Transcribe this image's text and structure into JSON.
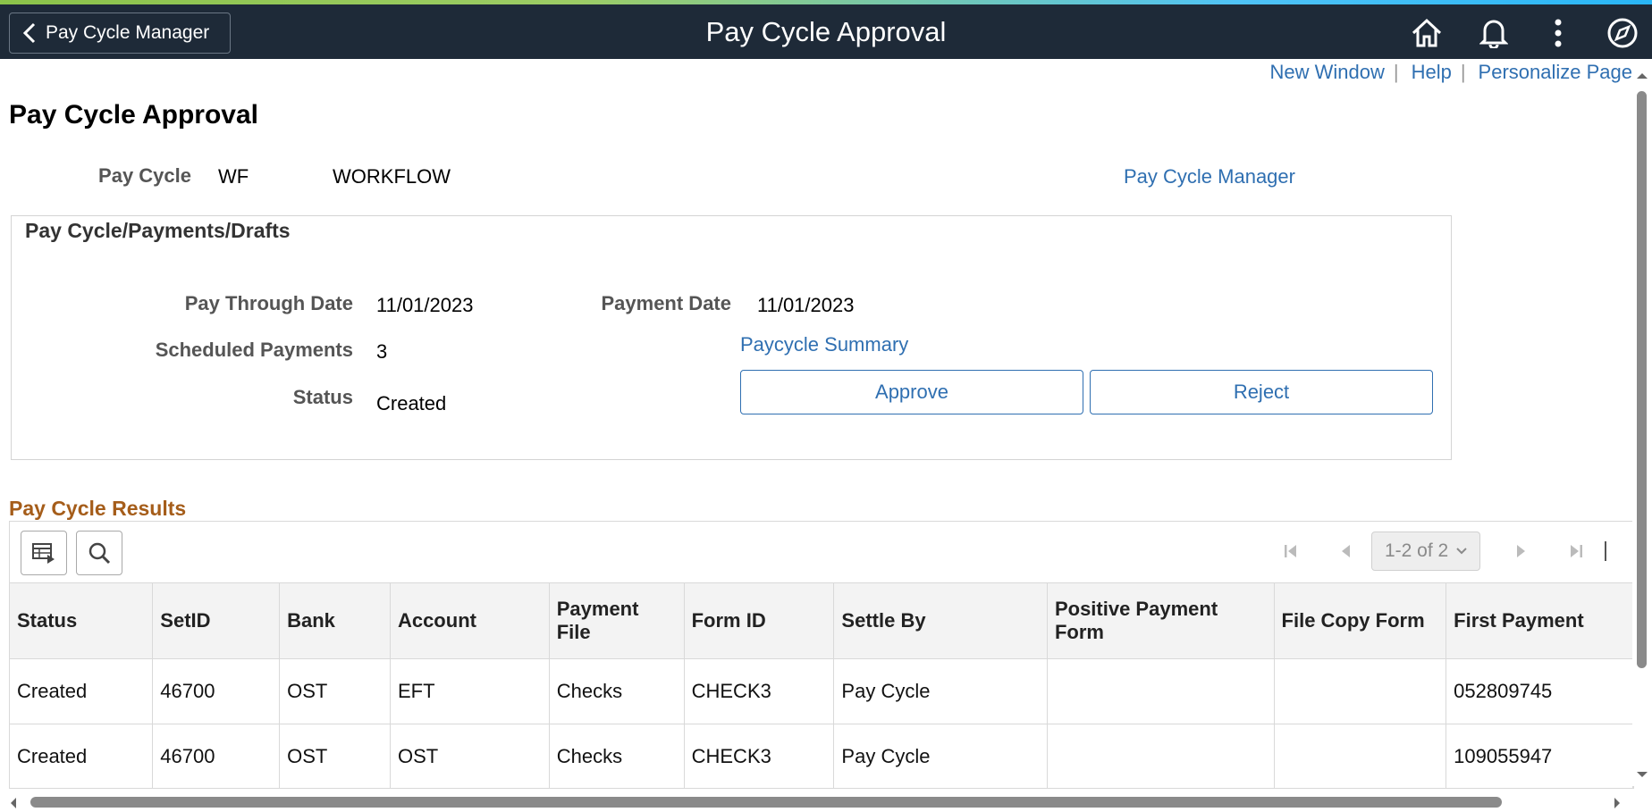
{
  "header": {
    "back_label": "Pay Cycle Manager",
    "title": "Pay Cycle Approval",
    "icons": [
      "home-icon",
      "notifications-icon",
      "actions-menu-icon",
      "navbar-compass-icon"
    ]
  },
  "utility_links": {
    "new_window": "New Window",
    "help": "Help",
    "personalize": "Personalize Page",
    "separator": "|"
  },
  "page": {
    "title": "Pay Cycle Approval",
    "pay_cycle_label": "Pay Cycle",
    "pay_cycle_code": "WF",
    "pay_cycle_desc": "WORKFLOW",
    "pay_cycle_manager_link": "Pay Cycle Manager"
  },
  "group": {
    "title": "Pay Cycle/Payments/Drafts",
    "pay_through_date_label": "Pay Through Date",
    "pay_through_date": "11/01/2023",
    "payment_date_label": "Payment Date",
    "payment_date": "11/01/2023",
    "scheduled_payments_label": "Scheduled Payments",
    "scheduled_payments": "3",
    "paycycle_summary_link": "Paycycle Summary",
    "status_label": "Status",
    "status": "Created",
    "approve_label": "Approve",
    "reject_label": "Reject"
  },
  "results": {
    "title": "Pay Cycle Results",
    "pager_text": "1-2 of 2",
    "columns": [
      "Status",
      "SetID",
      "Bank",
      "Account",
      "Payment File",
      "Form ID",
      "Settle By",
      "Positive Payment Form",
      "File Copy Form",
      "First Payment"
    ],
    "rows": [
      [
        "Created",
        "46700",
        "OST",
        "EFT",
        "Checks",
        "CHECK3",
        "Pay Cycle",
        "",
        "",
        "052809745"
      ],
      [
        "Created",
        "46700",
        "OST",
        "OST",
        "Checks",
        "CHECK3",
        "Pay Cycle",
        "",
        "",
        "109055947"
      ]
    ]
  },
  "colors": {
    "header_bg": "#1e2a38",
    "link": "#2f6fb1",
    "results_title": "#a55d1a"
  }
}
